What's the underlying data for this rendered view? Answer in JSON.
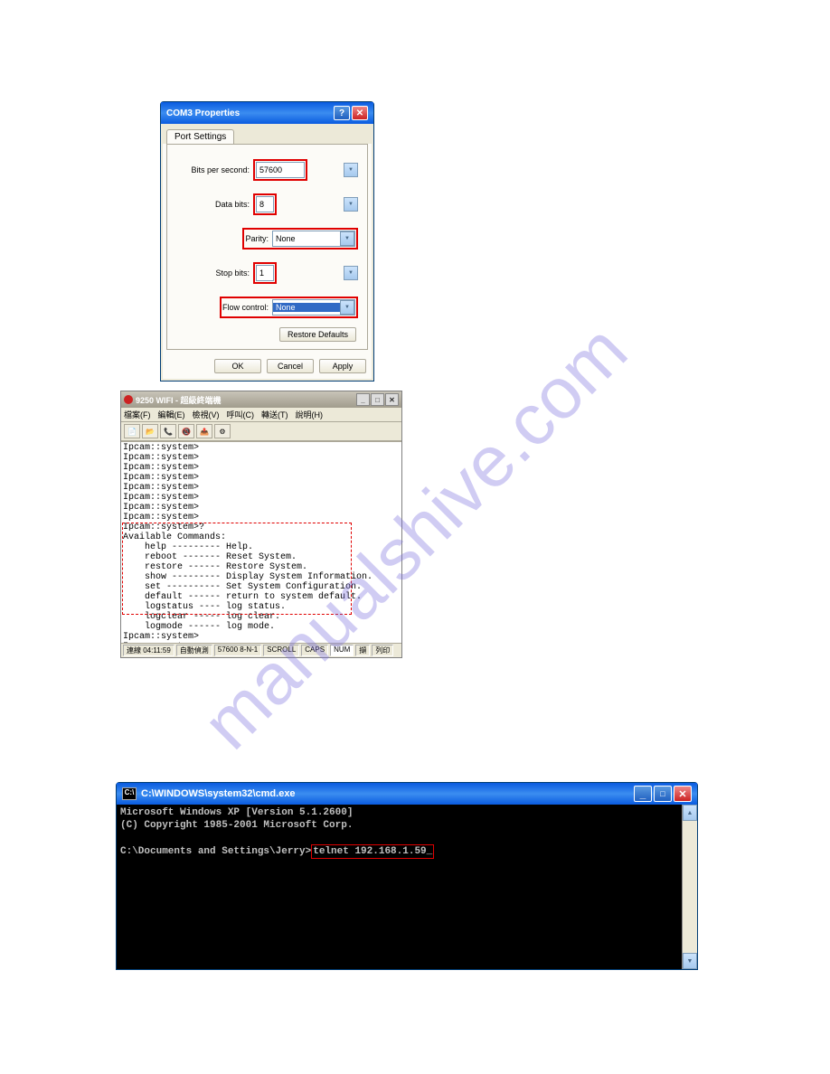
{
  "watermark": "manualshive.com",
  "com3": {
    "title": "COM3 Properties",
    "tab": "Port Settings",
    "fields": {
      "bps_label": "Bits per second:",
      "bps_value": "57600",
      "databits_label": "Data bits:",
      "databits_value": "8",
      "parity_label": "Parity:",
      "parity_value": "None",
      "stopbits_label": "Stop bits:",
      "stopbits_value": "1",
      "flow_label": "Flow control:",
      "flow_value": "None"
    },
    "restore": "Restore Defaults",
    "buttons": {
      "ok": "OK",
      "cancel": "Cancel",
      "apply": "Apply"
    }
  },
  "hyper": {
    "title": "9250 WIFI - 超級終端機",
    "menu": [
      "檔案(F)",
      "編輯(E)",
      "檢視(V)",
      "呼叫(C)",
      "轉送(T)",
      "說明(H)"
    ],
    "content": "Ipcam::system>\nIpcam::system>\nIpcam::system>\nIpcam::system>\nIpcam::system>\nIpcam::system>\nIpcam::system>\nIpcam::system>\nIpcam::system>?\nAvailable Commands:\n    help --------- Help.\n    reboot ------- Reset System.\n    restore ------ Restore System.\n    show --------- Display System Information.\n    set ---------- Set System Configuration.\n    default ------ return to system default.\n    logstatus ---- log status.\n    logclear ----- log clear.\n    logmode ------ log mode.\nIpcam::system>\nIpcam::system>_",
    "status": [
      "連線 04:11:59",
      "自動偵測",
      "57600 8-N-1",
      "SCROLL",
      "CAPS",
      "NUM",
      "擷",
      "列印"
    ]
  },
  "cmd": {
    "title": "C:\\WINDOWS\\system32\\cmd.exe",
    "line1": "Microsoft Windows XP [Version 5.1.2600]",
    "line2": "(C) Copyright 1985-2001 Microsoft Corp.",
    "prompt": "C:\\Documents and Settings\\Jerry>",
    "command": "telnet 192.168.1.59_"
  }
}
